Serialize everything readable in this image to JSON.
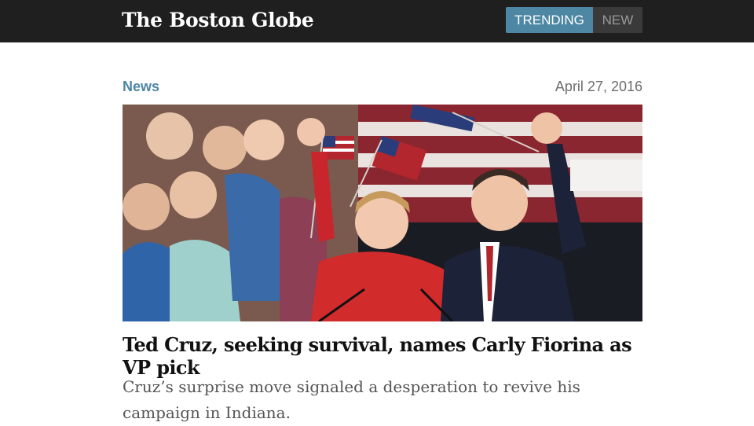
{
  "header": {
    "logo_text": "The Boston Globe",
    "tabs": [
      {
        "label": "TRENDING",
        "active": true
      },
      {
        "label": "NEW",
        "active": false
      }
    ]
  },
  "article": {
    "section": "News",
    "date": "April 27, 2016",
    "photo_description": "",
    "headline": "Ted Cruz, seeking survival, names Carly Fiorina as VP pick",
    "dek": "Cruz’s surprise move signaled a desperation to revive his campaign in Indiana."
  },
  "colors": {
    "topbar": "#1f1f1f",
    "accent": "#4d87a4",
    "section": "#4c86a5"
  }
}
